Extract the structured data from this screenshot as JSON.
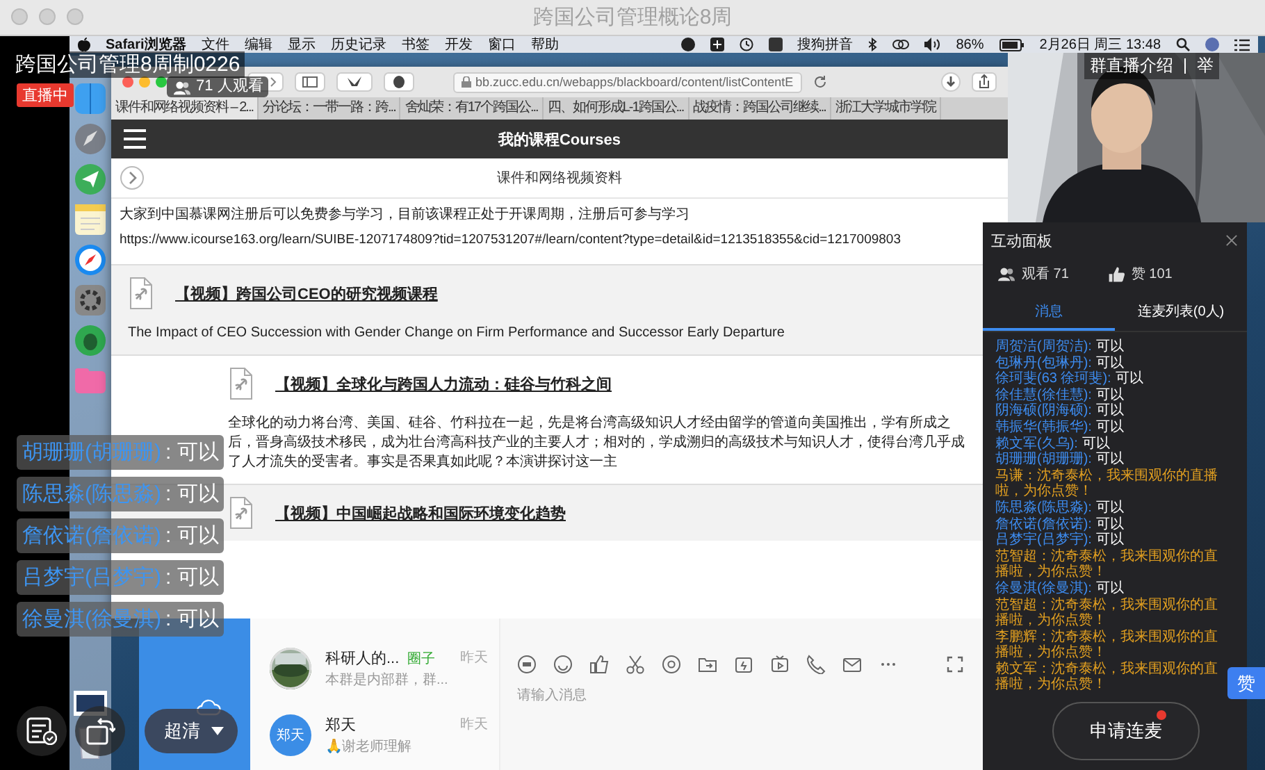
{
  "window": {
    "title": "跨国公司管理概论8周"
  },
  "menubar": {
    "app": "Safari浏览器",
    "menus": [
      "文件",
      "编辑",
      "显示",
      "历史记录",
      "书签",
      "开发",
      "窗口",
      "帮助"
    ],
    "input_method": "搜狗拼音",
    "battery": "86%",
    "clock": "2月26日 周三 13:48"
  },
  "safari": {
    "url": "bb.zucc.edu.cn/webapps/blackboard/content/listContentE",
    "tabs": [
      {
        "label": "课件和网络视频资料 – 2...",
        "selected": true
      },
      {
        "label": "分论坛：一带一路：跨...",
        "selected": false
      },
      {
        "label": "舍灿荣：有17个跨国公...",
        "selected": false
      },
      {
        "label": "四、如何形成L-1跨国公...",
        "selected": false
      },
      {
        "label": "战疫情：跨国公司继续...",
        "selected": false
      },
      {
        "label": "浙江大学城市学院",
        "selected": false
      }
    ],
    "page_title": "我的课程Courses",
    "section": "课件和网络视频资料",
    "intro": "大家到中国慕课网注册后可以免费参与学习，目前该课程正处于开课周期，注册后可参与学习",
    "link": "https://www.icourse163.org/learn/SUIBE-1207174809?tid=1207531207#/learn/content?type=detail&id=1213518355&cid=1217009803",
    "items": [
      {
        "title": "【视频】跨国公司CEO的研究视频课程",
        "description": "The Impact of CEO Succession with Gender Change on Firm Performance and Successor Early Departure"
      },
      {
        "title": "【视频】全球化与跨国人力流动：硅谷与竹科之间",
        "description": "全球化的动力将台湾、美国、硅谷、竹科拉在一起，先是将台湾高级知识人才经由留学的管道向美国推出，学有所成之后，晋身高级技术移民，成为壮台湾高科技产业的主要人才；相对的，学成溯归的高级技术与知识人才，使得台湾几乎成了人才流失的受害者。事实是否果真如此呢？本演讲探讨这一主"
      },
      {
        "title": "【视频】中国崛起战略和国际环境变化趋势"
      }
    ]
  },
  "chat_app": {
    "conversations": [
      {
        "name": "科研人的...",
        "tag": "圈子",
        "time": "昨天",
        "preview": "本群是内部群，群..."
      },
      {
        "name": "郑天",
        "avatar_text": "郑天",
        "time": "昨天",
        "preview": "🙏谢老师理解"
      }
    ],
    "placeholder": "请输入消息"
  },
  "stream": {
    "title": "跨国公司管理8周制0226",
    "live_badge": "直播中",
    "viewers": "71 人观看",
    "links": [
      "群直播介绍",
      "举"
    ],
    "comments": [
      {
        "name": "胡珊珊(胡珊珊)",
        "text": ": 可以"
      },
      {
        "name": "陈思淼(陈思淼)",
        "text": ": 可以"
      },
      {
        "name": "詹依诺(詹依诺)",
        "text": ": 可以"
      },
      {
        "name": "吕梦宇(吕梦宇)",
        "text": ": 可以"
      },
      {
        "name": "徐曼淇(徐曼淇)",
        "text": ": 可以"
      }
    ],
    "quality": "超清",
    "like_button": "赞",
    "mic_button": "申请连麦",
    "mic_alert": true
  },
  "panel": {
    "title": "互动面板",
    "views": "观看 71",
    "likes": "赞 101",
    "tabs": [
      {
        "label": "消息",
        "selected": true
      },
      {
        "label": "连麦列表(0人)",
        "selected": false
      }
    ],
    "messages": [
      {
        "kind": "comment",
        "name": "周贺洁(周贺洁):",
        "text": "可以"
      },
      {
        "kind": "comment",
        "name": "包琳丹(包琳丹):",
        "text": "可以"
      },
      {
        "kind": "comment",
        "name": "徐珂斐(63 徐珂斐):",
        "text": "可以"
      },
      {
        "kind": "comment",
        "name": "徐佳慧(徐佳慧):",
        "text": "可以"
      },
      {
        "kind": "comment",
        "name": "阴海硕(阴海硕):",
        "text": "可以"
      },
      {
        "kind": "comment",
        "name": "韩振华(韩振华):",
        "text": "可以"
      },
      {
        "kind": "comment",
        "name": "赖文军(久乌):",
        "text": "可以"
      },
      {
        "kind": "comment",
        "name": "胡珊珊(胡珊珊):",
        "text": "可以"
      },
      {
        "kind": "gift",
        "name": "马谦：",
        "text": "沈奇泰松，我来围观你的直播啦，为你点赞！"
      },
      {
        "kind": "comment",
        "name": "陈思淼(陈思淼):",
        "text": "可以"
      },
      {
        "kind": "comment",
        "name": "詹依诺(詹依诺):",
        "text": "可以"
      },
      {
        "kind": "comment",
        "name": "吕梦宇(吕梦宇):",
        "text": "可以"
      },
      {
        "kind": "gift",
        "name": "范智超：",
        "text": "沈奇泰松，我来围观你的直播啦，为你点赞！"
      },
      {
        "kind": "comment",
        "name": "徐曼淇(徐曼淇):",
        "text": "可以"
      },
      {
        "kind": "gift",
        "name": "范智超：",
        "text": "沈奇泰松，我来围观你的直播啦，为你点赞！"
      },
      {
        "kind": "gift",
        "name": "李鹏辉：",
        "text": "沈奇泰松，我来围观你的直播啦，为你点赞！"
      },
      {
        "kind": "gift",
        "name": "赖文军：",
        "text": "沈奇泰松，我来围观你的直播啦，为你点赞！"
      }
    ]
  }
}
